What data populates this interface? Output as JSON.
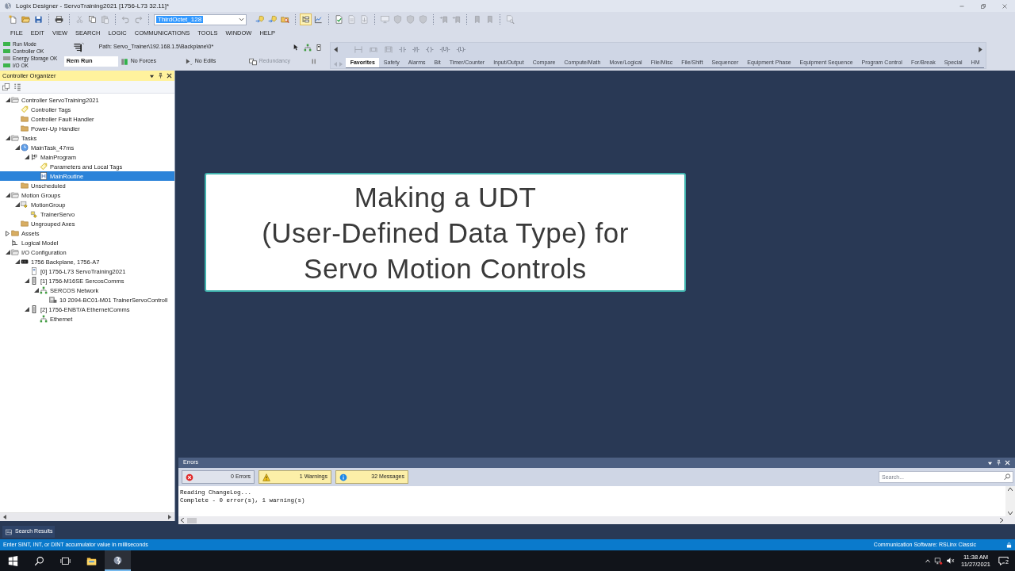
{
  "window": {
    "title": "Logix Designer - ServoTraining2021 [1756-L73 32.11]*"
  },
  "toolbar": {
    "left_groups": [
      [
        {
          "kind": "new",
          "disabled": false
        },
        {
          "kind": "open",
          "disabled": false
        },
        {
          "kind": "save",
          "disabled": false
        }
      ],
      [
        {
          "kind": "print",
          "disabled": false
        }
      ],
      [
        {
          "kind": "cut",
          "disabled": true
        },
        {
          "kind": "copy",
          "disabled": false
        },
        {
          "kind": "paste",
          "disabled": true
        }
      ],
      [
        {
          "kind": "undo",
          "disabled": true
        },
        {
          "kind": "redo",
          "disabled": true
        }
      ]
    ],
    "combo": {
      "value": "ThirdOctet_128"
    },
    "right_groups": [
      [
        {
          "kind": "go-to",
          "disabled": false
        },
        {
          "kind": "go-to",
          "disabled": false
        },
        {
          "kind": "browse",
          "disabled": false
        }
      ],
      [
        {
          "kind": "tree-view",
          "disabled": false,
          "pressed": true
        },
        {
          "kind": "chart",
          "disabled": false,
          "pressed": false
        }
      ],
      [
        {
          "kind": "verify",
          "disabled": false
        },
        {
          "kind": "document",
          "disabled": true
        },
        {
          "kind": "download",
          "disabled": true
        }
      ],
      [
        {
          "kind": "screen",
          "disabled": true
        },
        {
          "kind": "shield",
          "disabled": true
        },
        {
          "kind": "shield",
          "disabled": true
        },
        {
          "kind": "shield",
          "disabled": true
        }
      ],
      [
        {
          "kind": "bookmark-arrow",
          "disabled": true
        },
        {
          "kind": "bookmark-arrow",
          "disabled": true
        }
      ],
      [
        {
          "kind": "bookmark",
          "disabled": true
        },
        {
          "kind": "bookmark",
          "disabled": true
        }
      ],
      [
        {
          "kind": "find-document",
          "disabled": true
        }
      ]
    ]
  },
  "menu": [
    {
      "label": "FILE"
    },
    {
      "label": "EDIT"
    },
    {
      "label": "VIEW"
    },
    {
      "label": "SEARCH"
    },
    {
      "label": "LOGIC"
    },
    {
      "label": "COMMUNICATIONS"
    },
    {
      "label": "TOOLS"
    },
    {
      "label": "WINDOW"
    },
    {
      "label": "HELP"
    }
  ],
  "controller_status": [
    {
      "label": "Run Mode",
      "color": "#3cb44b"
    },
    {
      "label": "Controller OK",
      "color": "#3cb44b"
    },
    {
      "label": "Energy Storage OK",
      "color": "#9b9b9b"
    },
    {
      "label": "I/O OK",
      "color": "#3cb44b"
    }
  ],
  "online_bar": {
    "path": "Path: Servo_Trainer\\192.168.1.5\\Backplane\\0*",
    "mode": "Rem Run",
    "indicators": [
      {
        "kind": "forces",
        "label": "No Forces",
        "disabled": false
      },
      {
        "kind": "edits",
        "label": "No Edits",
        "disabled": false
      },
      {
        "kind": "redundancy",
        "label": "Redundancy",
        "disabled": true
      }
    ]
  },
  "instruction_toolbar": {
    "tools": [
      {
        "kind": "rung",
        "disabled": true
      },
      {
        "kind": "branch",
        "disabled": true
      },
      {
        "kind": "branch-level",
        "disabled": true
      }
    ],
    "elements": [
      {
        "symbol": "-| |-",
        "disabled": true
      },
      {
        "symbol": "-|/|-",
        "disabled": true
      },
      {
        "symbol": "-( )-",
        "disabled": true
      },
      {
        "symbol": "-(U)-",
        "disabled": true
      },
      {
        "symbol": "-(L)-",
        "disabled": true
      }
    ],
    "tabs": [
      {
        "label": "Favorites",
        "selected": true
      },
      {
        "label": "Safety",
        "selected": false
      },
      {
        "label": "Alarms",
        "selected": false
      },
      {
        "label": "Bit",
        "selected": false
      },
      {
        "label": "Timer/Counter",
        "selected": false
      },
      {
        "label": "Input/Output",
        "selected": false
      },
      {
        "label": "Compare",
        "selected": false
      },
      {
        "label": "Compute/Math",
        "selected": false
      },
      {
        "label": "Move/Logical",
        "selected": false
      },
      {
        "label": "File/Misc",
        "selected": false
      },
      {
        "label": "File/Shift",
        "selected": false
      },
      {
        "label": "Sequencer",
        "selected": false
      },
      {
        "label": "Equipment Phase",
        "selected": false
      },
      {
        "label": "Equipment Sequence",
        "selected": false
      },
      {
        "label": "Program Control",
        "selected": false
      },
      {
        "label": "For/Break",
        "selected": false
      },
      {
        "label": "Special",
        "selected": false
      },
      {
        "label": "HM",
        "selected": false
      }
    ]
  },
  "controller_organizer": {
    "title": "Controller Organizer",
    "tree": [
      {
        "kind": "controller",
        "label": "Controller ServoTraining2021",
        "expanded": true,
        "selected": false,
        "children": [
          {
            "kind": "tags",
            "label": "Controller Tags",
            "selected": false
          },
          {
            "kind": "folder",
            "label": "Controller Fault Handler",
            "selected": false
          },
          {
            "kind": "folder",
            "label": "Power-Up Handler",
            "selected": false
          }
        ]
      },
      {
        "kind": "controller",
        "label": "Tasks",
        "expanded": true,
        "selected": false,
        "children": [
          {
            "kind": "task",
            "label": "MainTask_47ms",
            "expanded": true,
            "selected": false,
            "children": [
              {
                "kind": "program",
                "label": "MainProgram",
                "expanded": true,
                "selected": false,
                "children": [
                  {
                    "kind": "tags",
                    "label": "Parameters and Local Tags",
                    "selected": false
                  },
                  {
                    "kind": "routine",
                    "label": "MainRoutine",
                    "selected": true
                  }
                ]
              }
            ]
          },
          {
            "kind": "folder",
            "label": "Unscheduled",
            "selected": false
          }
        ]
      },
      {
        "kind": "controller",
        "label": "Motion Groups",
        "expanded": true,
        "selected": false,
        "children": [
          {
            "kind": "motion-group",
            "label": "MotionGroup",
            "expanded": true,
            "selected": false,
            "children": [
              {
                "kind": "axis",
                "label": "TrainerServo",
                "selected": false
              }
            ]
          },
          {
            "kind": "folder",
            "label": "Ungrouped Axes",
            "selected": false
          }
        ]
      },
      {
        "kind": "folder",
        "label": "Assets",
        "expanded": false,
        "selected": false
      },
      {
        "kind": "model",
        "label": "Logical Model",
        "selected": false
      },
      {
        "kind": "controller",
        "label": "I/O Configuration",
        "expanded": true,
        "selected": false,
        "children": [
          {
            "kind": "backplane",
            "label": "1756 Backplane, 1756-A7",
            "expanded": true,
            "selected": false,
            "children": [
              {
                "kind": "processor",
                "label": "[0] 1756-L73 ServoTraining2021",
                "selected": false
              },
              {
                "kind": "module",
                "label": "[1] 1756-M16SE SercosComms",
                "expanded": true,
                "selected": false,
                "children": [
                  {
                    "kind": "network",
                    "label": "SERCOS Network",
                    "expanded": true,
                    "selected": false,
                    "children": [
                      {
                        "kind": "drive",
                        "label": "10 2094-BC01-M01 TrainerServoControll",
                        "selected": false
                      }
                    ]
                  }
                ]
              },
              {
                "kind": "module",
                "label": "[2] 1756-ENBT/A EthernetComms",
                "expanded": true,
                "selected": false,
                "children": [
                  {
                    "kind": "network",
                    "label": "Ethernet",
                    "selected": false
                  }
                ]
              }
            ]
          }
        ]
      }
    ]
  },
  "editor": {
    "title_card": "Making a UDT\n(User-Defined Data Type) for\nServo Motion Controls"
  },
  "errors_panel": {
    "title": "Errors",
    "filters": [
      {
        "kind": "errors",
        "label": "0 Errors",
        "selected": false
      },
      {
        "kind": "warnings",
        "label": "1 Warnings",
        "selected": true
      },
      {
        "kind": "messages",
        "label": "32 Messages",
        "selected": true
      }
    ],
    "search": {
      "placeholder": "Search..."
    },
    "log": [
      "Reading ChangeLog...",
      "Complete - 0 error(s), 1 warning(s)"
    ]
  },
  "bottom_tabs": [
    {
      "label": "Search Results"
    }
  ],
  "status_bar": {
    "message": "Enter SINT, INT, or DINT accumulator value in milliseconds",
    "connection": "Communication Software: RSLinx Classic"
  },
  "taskbar": {
    "time": "11:38 AM",
    "date": "11/27/2021",
    "notification_count": "2"
  }
}
